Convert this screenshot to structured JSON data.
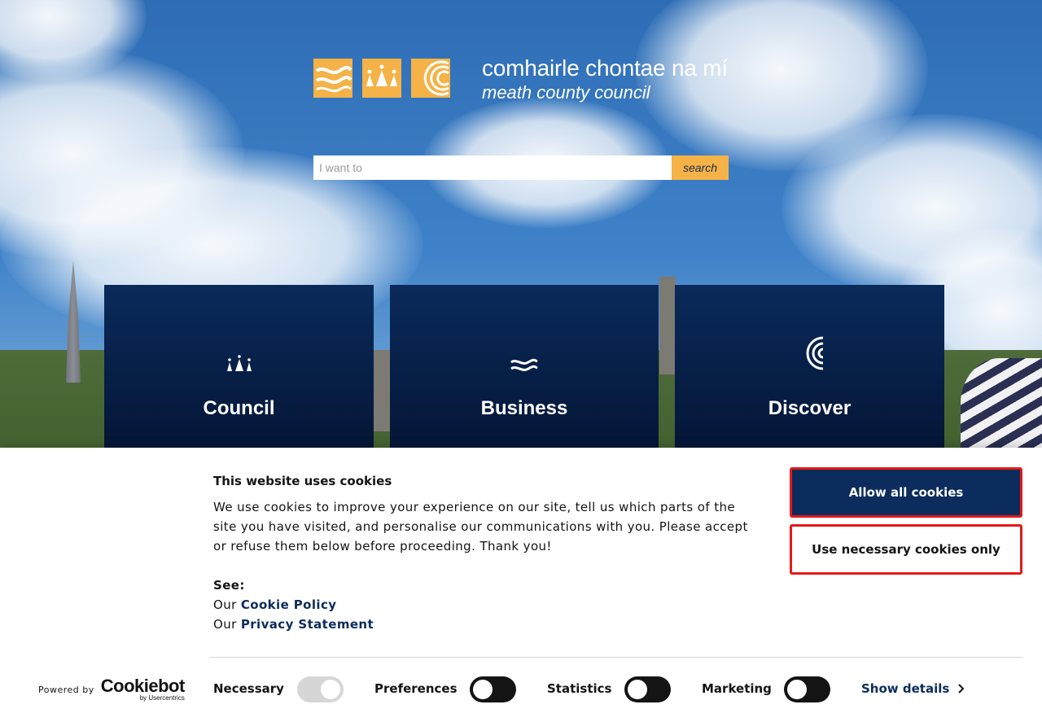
{
  "brand": {
    "line1": "comhairle chontae na mí",
    "line2": "meath county council",
    "accent": "#f4b247",
    "navy": "#0b2c5c"
  },
  "search": {
    "placeholder": "I want to",
    "value": "",
    "button_label": "search"
  },
  "tiles": [
    {
      "label": "Council",
      "icon": "crown-icon"
    },
    {
      "label": "Business",
      "icon": "waves-icon"
    },
    {
      "label": "Discover",
      "icon": "spiral-icon"
    }
  ],
  "cookie_banner": {
    "title": "This website uses cookies",
    "body": "We use cookies to improve your experience on our site, tell us which parts of the site you have visited, and personalise our communications with you. Please accept or refuse them below before proceeding. Thank you!",
    "see_label": "See:",
    "our_prefix": "Our",
    "cookie_policy": "Cookie Policy",
    "privacy_statement": "Privacy Statement",
    "allow_all": "Allow all cookies",
    "necessary_only": "Use necessary cookies only",
    "powered_by": "Powered by",
    "provider": "Cookiebot",
    "provider_sub": "by Usercentrics",
    "toggles": [
      {
        "label": "Necessary",
        "state": "on-disabled"
      },
      {
        "label": "Preferences",
        "state": "off"
      },
      {
        "label": "Statistics",
        "state": "off"
      },
      {
        "label": "Marketing",
        "state": "off"
      }
    ],
    "show_details": "Show details"
  }
}
